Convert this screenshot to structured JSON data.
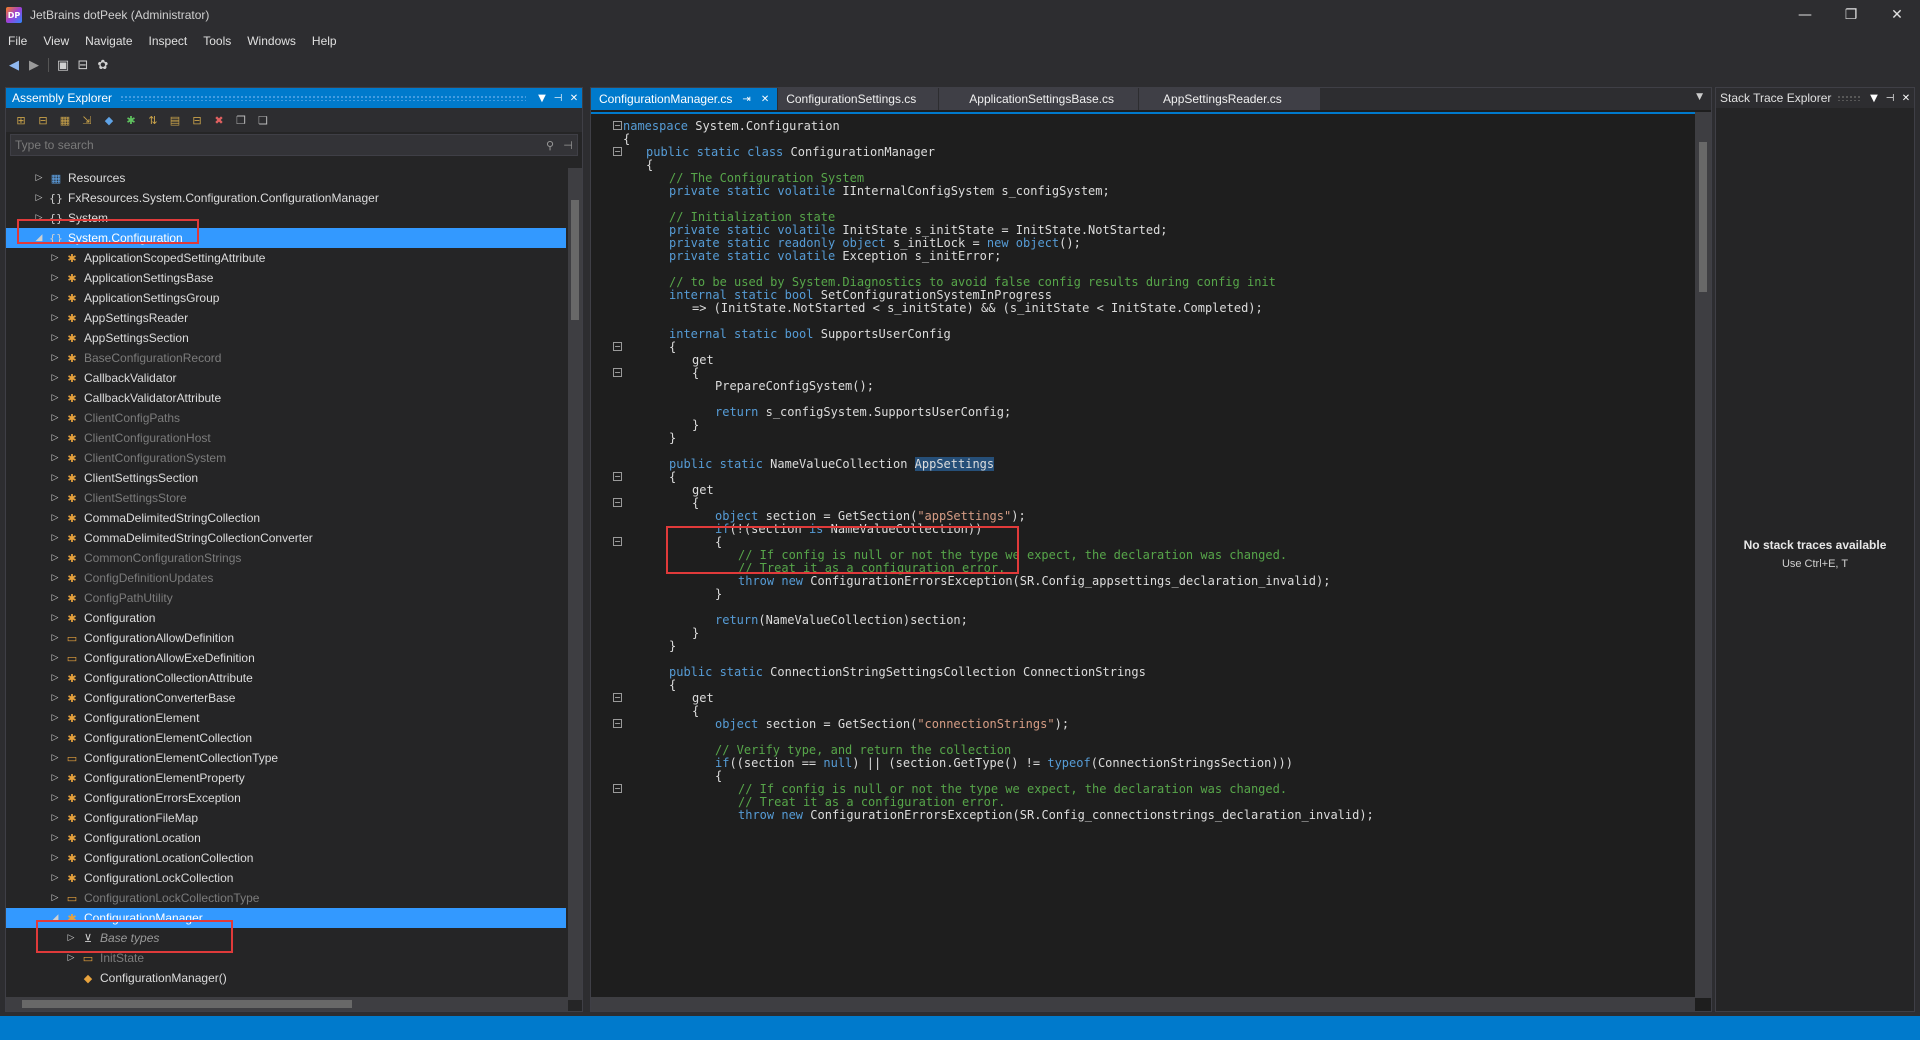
{
  "window": {
    "title": "JetBrains dotPeek (Administrator)",
    "logo_text": "DP",
    "controls": [
      "—",
      "❐",
      "✕"
    ]
  },
  "menu": [
    "File",
    "View",
    "Navigate",
    "Inspect",
    "Tools",
    "Windows",
    "Help"
  ],
  "toolbar_icons": [
    "back-icon",
    "forward-icon",
    "assembly-icon",
    "open-icon",
    "gear-icon"
  ],
  "assembly_explorer": {
    "title": "Assembly Explorer",
    "search_placeholder": "Type to search",
    "tree": [
      {
        "label": "Resources",
        "indent": 1,
        "expander": "▷",
        "icon": "resources",
        "state": ""
      },
      {
        "label": "FxResources.System.Configuration.ConfigurationManager",
        "indent": 1,
        "expander": "▷",
        "icon": "namespace",
        "state": ""
      },
      {
        "label": "System",
        "indent": 1,
        "expander": "▷",
        "icon": "namespace",
        "state": ""
      },
      {
        "label": "System.Configuration",
        "indent": 1,
        "expander": "◢",
        "icon": "namespace",
        "state": "selected"
      },
      {
        "label": "ApplicationScopedSettingAttribute",
        "indent": 2,
        "expander": "▷",
        "icon": "class",
        "state": ""
      },
      {
        "label": "ApplicationSettingsBase",
        "indent": 2,
        "expander": "▷",
        "icon": "class",
        "state": ""
      },
      {
        "label": "ApplicationSettingsGroup",
        "indent": 2,
        "expander": "▷",
        "icon": "class",
        "state": ""
      },
      {
        "label": "AppSettingsReader",
        "indent": 2,
        "expander": "▷",
        "icon": "class",
        "state": ""
      },
      {
        "label": "AppSettingsSection",
        "indent": 2,
        "expander": "▷",
        "icon": "class",
        "state": ""
      },
      {
        "label": "BaseConfigurationRecord",
        "indent": 2,
        "expander": "▷",
        "icon": "class",
        "state": "dim"
      },
      {
        "label": "CallbackValidator",
        "indent": 2,
        "expander": "▷",
        "icon": "class",
        "state": ""
      },
      {
        "label": "CallbackValidatorAttribute",
        "indent": 2,
        "expander": "▷",
        "icon": "class",
        "state": ""
      },
      {
        "label": "ClientConfigPaths",
        "indent": 2,
        "expander": "▷",
        "icon": "class",
        "state": "dim"
      },
      {
        "label": "ClientConfigurationHost",
        "indent": 2,
        "expander": "▷",
        "icon": "class",
        "state": "dim"
      },
      {
        "label": "ClientConfigurationSystem",
        "indent": 2,
        "expander": "▷",
        "icon": "class",
        "state": "dim"
      },
      {
        "label": "ClientSettingsSection",
        "indent": 2,
        "expander": "▷",
        "icon": "class",
        "state": ""
      },
      {
        "label": "ClientSettingsStore",
        "indent": 2,
        "expander": "▷",
        "icon": "class",
        "state": "dim"
      },
      {
        "label": "CommaDelimitedStringCollection",
        "indent": 2,
        "expander": "▷",
        "icon": "class",
        "state": ""
      },
      {
        "label": "CommaDelimitedStringCollectionConverter",
        "indent": 2,
        "expander": "▷",
        "icon": "class",
        "state": ""
      },
      {
        "label": "CommonConfigurationStrings",
        "indent": 2,
        "expander": "▷",
        "icon": "class",
        "state": "dim"
      },
      {
        "label": "ConfigDefinitionUpdates",
        "indent": 2,
        "expander": "▷",
        "icon": "class",
        "state": "dim"
      },
      {
        "label": "ConfigPathUtility",
        "indent": 2,
        "expander": "▷",
        "icon": "class",
        "state": "dim"
      },
      {
        "label": "Configuration",
        "indent": 2,
        "expander": "▷",
        "icon": "class",
        "state": ""
      },
      {
        "label": "ConfigurationAllowDefinition",
        "indent": 2,
        "expander": "▷",
        "icon": "enum",
        "state": ""
      },
      {
        "label": "ConfigurationAllowExeDefinition",
        "indent": 2,
        "expander": "▷",
        "icon": "enum",
        "state": ""
      },
      {
        "label": "ConfigurationCollectionAttribute",
        "indent": 2,
        "expander": "▷",
        "icon": "class",
        "state": ""
      },
      {
        "label": "ConfigurationConverterBase",
        "indent": 2,
        "expander": "▷",
        "icon": "class",
        "state": ""
      },
      {
        "label": "ConfigurationElement",
        "indent": 2,
        "expander": "▷",
        "icon": "class",
        "state": ""
      },
      {
        "label": "ConfigurationElementCollection",
        "indent": 2,
        "expander": "▷",
        "icon": "class",
        "state": ""
      },
      {
        "label": "ConfigurationElementCollectionType",
        "indent": 2,
        "expander": "▷",
        "icon": "enum",
        "state": ""
      },
      {
        "label": "ConfigurationElementProperty",
        "indent": 2,
        "expander": "▷",
        "icon": "class",
        "state": ""
      },
      {
        "label": "ConfigurationErrorsException",
        "indent": 2,
        "expander": "▷",
        "icon": "class",
        "state": ""
      },
      {
        "label": "ConfigurationFileMap",
        "indent": 2,
        "expander": "▷",
        "icon": "class",
        "state": ""
      },
      {
        "label": "ConfigurationLocation",
        "indent": 2,
        "expander": "▷",
        "icon": "class",
        "state": ""
      },
      {
        "label": "ConfigurationLocationCollection",
        "indent": 2,
        "expander": "▷",
        "icon": "class",
        "state": ""
      },
      {
        "label": "ConfigurationLockCollection",
        "indent": 2,
        "expander": "▷",
        "icon": "class",
        "state": ""
      },
      {
        "label": "ConfigurationLockCollectionType",
        "indent": 2,
        "expander": "▷",
        "icon": "enum",
        "state": "dim"
      },
      {
        "label": "ConfigurationManager",
        "indent": 2,
        "expander": "◢",
        "icon": "class",
        "state": "selected"
      },
      {
        "label": "Base types",
        "indent": 3,
        "expander": "▷",
        "icon": "basetypes",
        "state": "italic"
      },
      {
        "label": "InitState",
        "indent": 3,
        "expander": "▷",
        "icon": "enum",
        "state": "dim"
      },
      {
        "label": "ConfigurationManager()",
        "indent": 3,
        "expander": "",
        "icon": "method",
        "state": ""
      }
    ]
  },
  "editor": {
    "tabs": [
      {
        "label": "ConfigurationManager.cs",
        "active": true,
        "pin": "⇥",
        "close": "✕"
      },
      {
        "label": "ConfigurationSettings.cs",
        "active": false
      },
      {
        "label": "ApplicationSettingsBase.cs",
        "active": false
      },
      {
        "label": "AppSettingsReader.cs",
        "active": false
      }
    ],
    "code": [
      {
        "indent": 0,
        "parts": [
          [
            "kw",
            "namespace"
          ],
          [
            "",
            "System.Configuration"
          ]
        ]
      },
      {
        "indent": 0,
        "parts": [
          [
            "",
            "{"
          ]
        ]
      },
      {
        "indent": 1,
        "parts": [
          [
            "kw",
            "public static class"
          ],
          [
            "",
            "ConfigurationManager"
          ]
        ]
      },
      {
        "indent": 1,
        "parts": [
          [
            "",
            "{"
          ]
        ]
      },
      {
        "indent": 2,
        "parts": [
          [
            "cm",
            "// The Configuration System"
          ]
        ]
      },
      {
        "indent": 2,
        "parts": [
          [
            "kw",
            "private static volatile"
          ],
          [
            "",
            "IInternalConfigSystem s_configSystem;"
          ]
        ]
      },
      {
        "indent": 0,
        "parts": []
      },
      {
        "indent": 2,
        "parts": [
          [
            "cm",
            "// Initialization state"
          ]
        ]
      },
      {
        "indent": 2,
        "parts": [
          [
            "kw",
            "private static volatile"
          ],
          [
            "",
            "InitState s_initState = InitState.NotStarted;"
          ]
        ]
      },
      {
        "indent": 2,
        "parts": [
          [
            "kw",
            "private static readonly object"
          ],
          [
            "",
            "s_initLock = "
          ],
          [
            "kw",
            "new object"
          ],
          [
            "",
            "();"
          ]
        ]
      },
      {
        "indent": 2,
        "parts": [
          [
            "kw",
            "private static volatile"
          ],
          [
            "",
            "Exception s_initError;"
          ]
        ]
      },
      {
        "indent": 0,
        "parts": []
      },
      {
        "indent": 2,
        "parts": [
          [
            "cm",
            "// to be used by System.Diagnostics to avoid false config results during config init"
          ]
        ]
      },
      {
        "indent": 2,
        "parts": [
          [
            "kw",
            "internal static bool"
          ],
          [
            "",
            "SetConfigurationSystemInProgress"
          ]
        ]
      },
      {
        "indent": 3,
        "parts": [
          [
            "",
            "=> (InitState.NotStarted < s_initState) && (s_initState < InitState.Completed);"
          ]
        ]
      },
      {
        "indent": 0,
        "parts": []
      },
      {
        "indent": 2,
        "parts": [
          [
            "kw",
            "internal static bool"
          ],
          [
            "",
            "SupportsUserConfig"
          ]
        ]
      },
      {
        "indent": 2,
        "parts": [
          [
            "",
            "{"
          ]
        ]
      },
      {
        "indent": 3,
        "parts": [
          [
            "",
            "get"
          ]
        ]
      },
      {
        "indent": 3,
        "parts": [
          [
            "",
            "{"
          ]
        ]
      },
      {
        "indent": 4,
        "parts": [
          [
            "",
            "PrepareConfigSystem();"
          ]
        ]
      },
      {
        "indent": 0,
        "parts": []
      },
      {
        "indent": 4,
        "parts": [
          [
            "kw",
            "return"
          ],
          [
            "",
            "s_configSystem.SupportsUserConfig;"
          ]
        ]
      },
      {
        "indent": 3,
        "parts": [
          [
            "",
            "}"
          ]
        ]
      },
      {
        "indent": 2,
        "parts": [
          [
            "",
            "}"
          ]
        ]
      },
      {
        "indent": 0,
        "parts": []
      },
      {
        "indent": 2,
        "parts": [
          [
            "kw",
            "public static"
          ],
          [
            "",
            "NameValueCollection "
          ],
          [
            "sel",
            "AppSettings"
          ]
        ]
      },
      {
        "indent": 2,
        "parts": [
          [
            "",
            "{"
          ]
        ]
      },
      {
        "indent": 3,
        "parts": [
          [
            "",
            "get"
          ]
        ]
      },
      {
        "indent": 3,
        "parts": [
          [
            "",
            "{"
          ]
        ]
      },
      {
        "indent": 4,
        "parts": [
          [
            "kw",
            "object"
          ],
          [
            "",
            "section = GetSection("
          ],
          [
            "str",
            "\"appSettings\""
          ],
          [
            "",
            ");"
          ]
        ]
      },
      {
        "indent": 4,
        "parts": [
          [
            "kw",
            "if"
          ],
          [
            "",
            "(!(section "
          ],
          [
            "kw",
            "is"
          ],
          [
            "",
            "NameValueCollection))"
          ]
        ]
      },
      {
        "indent": 4,
        "parts": [
          [
            "",
            "{"
          ]
        ]
      },
      {
        "indent": 5,
        "parts": [
          [
            "cm",
            "// If config is null or not the type we expect, the declaration was changed."
          ]
        ]
      },
      {
        "indent": 5,
        "parts": [
          [
            "cm",
            "// Treat it as a configuration error."
          ]
        ]
      },
      {
        "indent": 5,
        "parts": [
          [
            "kw",
            "throw new"
          ],
          [
            "",
            "ConfigurationErrorsException(SR.Config_appsettings_declaration_invalid);"
          ]
        ]
      },
      {
        "indent": 4,
        "parts": [
          [
            "",
            "}"
          ]
        ]
      },
      {
        "indent": 0,
        "parts": []
      },
      {
        "indent": 4,
        "parts": [
          [
            "kw",
            "return"
          ],
          [
            "",
            "(NameValueCollection)section;"
          ]
        ]
      },
      {
        "indent": 3,
        "parts": [
          [
            "",
            "}"
          ]
        ]
      },
      {
        "indent": 2,
        "parts": [
          [
            "",
            "}"
          ]
        ]
      },
      {
        "indent": 0,
        "parts": []
      },
      {
        "indent": 2,
        "parts": [
          [
            "kw",
            "public static"
          ],
          [
            "",
            "ConnectionStringSettingsCollection ConnectionStrings"
          ]
        ]
      },
      {
        "indent": 2,
        "parts": [
          [
            "",
            "{"
          ]
        ]
      },
      {
        "indent": 3,
        "parts": [
          [
            "",
            "get"
          ]
        ]
      },
      {
        "indent": 3,
        "parts": [
          [
            "",
            "{"
          ]
        ]
      },
      {
        "indent": 4,
        "parts": [
          [
            "kw",
            "object"
          ],
          [
            "",
            "section = GetSection("
          ],
          [
            "str",
            "\"connectionStrings\""
          ],
          [
            "",
            ");"
          ]
        ]
      },
      {
        "indent": 0,
        "parts": []
      },
      {
        "indent": 4,
        "parts": [
          [
            "cm",
            "// Verify type, and return the collection"
          ]
        ]
      },
      {
        "indent": 4,
        "parts": [
          [
            "kw",
            "if"
          ],
          [
            "",
            "((section == "
          ],
          [
            "kw",
            "null"
          ],
          [
            "",
            ") || (section.GetType() != "
          ],
          [
            "kw",
            "typeof"
          ],
          [
            "",
            "(ConnectionStringsSection)))"
          ]
        ]
      },
      {
        "indent": 4,
        "parts": [
          [
            "",
            "{"
          ]
        ]
      },
      {
        "indent": 5,
        "parts": [
          [
            "cm",
            "// If config is null or not the type we expect, the declaration was changed."
          ]
        ]
      },
      {
        "indent": 5,
        "parts": [
          [
            "cm",
            "// Treat it as a configuration error."
          ]
        ]
      },
      {
        "indent": 5,
        "parts": [
          [
            "kw",
            "throw new"
          ],
          [
            "",
            "ConfigurationErrorsException(SR.Config_connectionstrings_declaration_invalid);"
          ]
        ]
      }
    ]
  },
  "stack_trace_explorer": {
    "title": "Stack Trace Explorer",
    "empty_title": "No stack traces available",
    "empty_hint": "Use Ctrl+E, T"
  }
}
